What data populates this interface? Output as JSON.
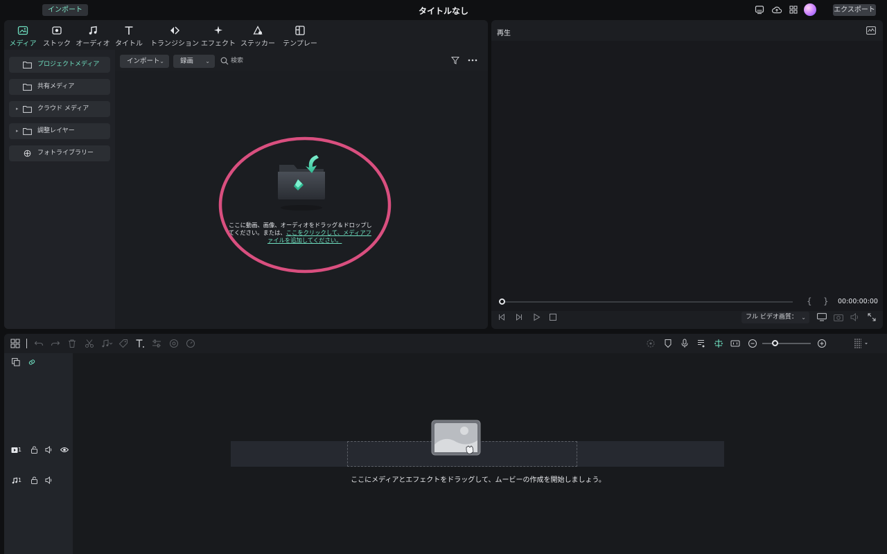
{
  "titlebar": {
    "import_label": "インポート",
    "title": "タイトルなし",
    "export_label": "エクスポート",
    "icons": [
      "monitor-icon",
      "cloud-upload-icon",
      "apps-grid-icon",
      "avatar"
    ]
  },
  "tabs": [
    {
      "label": "メディア",
      "icon": "media-icon",
      "active": true
    },
    {
      "label": "ストック",
      "icon": "stock-icon",
      "active": false
    },
    {
      "label": "オーディオ",
      "icon": "music-note-icon",
      "active": false
    },
    {
      "label": "タイトル",
      "icon": "text-t-icon",
      "active": false
    },
    {
      "label": "トランジション",
      "icon": "transition-icon",
      "active": false
    },
    {
      "label": "エフェクト",
      "icon": "effect-sparkle-icon",
      "active": false
    },
    {
      "label": "ステッカー",
      "icon": "sticker-icon",
      "active": false
    },
    {
      "label": "テンプレート",
      "icon": "template-icon",
      "active": false
    }
  ],
  "sidebar": {
    "items": [
      {
        "label": "プロジェクトメディア",
        "icon": "folder-icon",
        "active": true
      },
      {
        "label": "共有メディア",
        "icon": "folder-icon",
        "active": false
      },
      {
        "label": "クラウド メディア",
        "icon": "folder-icon",
        "active": false,
        "expandable": true
      },
      {
        "label": "調整レイヤー",
        "icon": "folder-icon",
        "active": false,
        "expandable": true
      },
      {
        "label": "フォトライブラリー",
        "icon": "photo-library-icon",
        "active": false
      }
    ]
  },
  "media_toolbar": {
    "import_dropdown": "インポート",
    "record_dropdown": "録画",
    "search_placeholder": "検索"
  },
  "media_empty": {
    "line1": "ここに動画、画像、オーディオをドラッグ＆ドロップし",
    "line2_prefix": "てください。または、",
    "link1": "ここをクリックして、メディアフ",
    "link2": "ァイルを追加してください。"
  },
  "preview": {
    "title": "再生",
    "timecode": "00:00:00:00",
    "quality": "フル ビデオ画質：",
    "progress": 0
  },
  "timeline": {
    "tracks": [
      {
        "type": "video",
        "label": "1"
      },
      {
        "type": "audio",
        "label": "1"
      }
    ],
    "hint": "ここにメディアとエフェクトをドラッグして、ムービーの作成を開始しましょう。"
  },
  "colors": {
    "accent": "#6fe0c0",
    "highlight_ring": "#d94f7f",
    "panel": "#1c1e22",
    "background": "#0f1012"
  }
}
